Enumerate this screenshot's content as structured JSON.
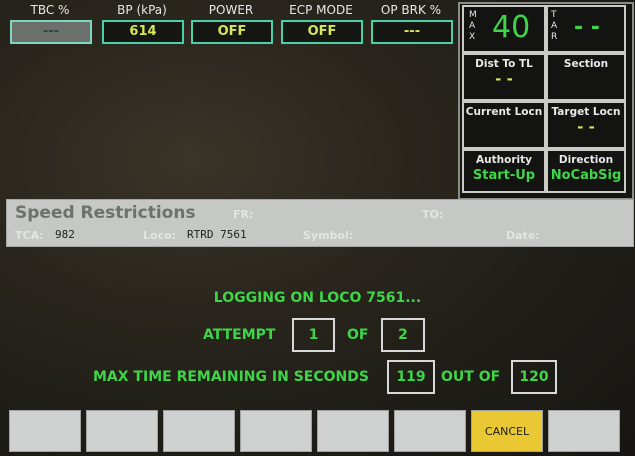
{
  "status_bar": [
    {
      "label": "TBC %",
      "value": "---"
    },
    {
      "label": "BP (kPa)",
      "value": "614"
    },
    {
      "label": "POWER",
      "value": "OFF"
    },
    {
      "label": "ECP MODE",
      "value": "OFF"
    },
    {
      "label": "OP BRK %",
      "value": "---"
    }
  ],
  "speed_panel": {
    "max_label": "MAX",
    "max_value": "40",
    "tar_label": "TAR",
    "tar_value": "- -",
    "dist_to_tl": {
      "title": "Dist To TL",
      "value": "- -"
    },
    "section": {
      "title": "Section",
      "value": ""
    },
    "current_locn": {
      "title": "Current Locn",
      "value": ""
    },
    "target_locn": {
      "title": "Target Locn",
      "value": "- -"
    },
    "authority": {
      "title": "Authority",
      "value": "Start-Up"
    },
    "direction": {
      "title": "Direction",
      "value": "NoCabSig"
    }
  },
  "speed_restrictions": {
    "title": "Speed Restrictions",
    "fr_label": "FR:",
    "to_label": "TO:",
    "tca_label": "TCA:",
    "tca_value": "982",
    "loco_label": "Loco:",
    "loco_value": "RTRD 7561",
    "symbol_label": "Symbol:",
    "date_label": "Date:"
  },
  "logon": {
    "message": "LOGGING ON LOCO 7561...",
    "attempt_label": "ATTEMPT",
    "attempt_value": "1",
    "of_label": "OF",
    "attempt_total": "2",
    "time_label": "MAX TIME REMAINING IN SECONDS",
    "time_value": "119",
    "out_of_label": "OUT OF",
    "time_total": "120"
  },
  "softkeys": [
    "",
    "",
    "",
    "",
    "",
    "",
    "CANCEL",
    ""
  ]
}
